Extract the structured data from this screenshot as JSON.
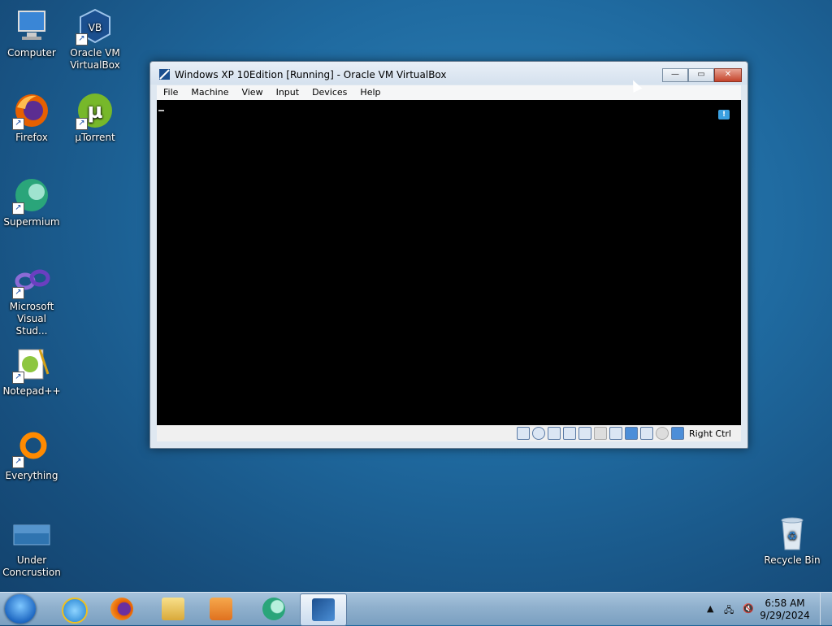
{
  "desktop": {
    "icons": [
      {
        "label": "Computer",
        "icon": "computer-icon"
      },
      {
        "label": "Oracle VM VirtualBox",
        "icon": "virtualbox-icon"
      },
      {
        "label": "Firefox",
        "icon": "firefox-icon"
      },
      {
        "label": "µTorrent",
        "icon": "utorrent-icon"
      },
      {
        "label": "Supermium",
        "icon": "supermium-icon"
      },
      {
        "label": "Microsoft Visual Stud...",
        "icon": "visual-studio-icon"
      },
      {
        "label": "Notepad++",
        "icon": "notepad-plus-plus-icon"
      },
      {
        "label": "Everything",
        "icon": "everything-icon"
      },
      {
        "label": "Under Concrustion",
        "icon": "folder-image-icon"
      },
      {
        "label": "Recycle Bin",
        "icon": "recycle-bin-icon"
      }
    ]
  },
  "window": {
    "title": "Windows XP 10Edition [Running] - Oracle VM VirtualBox",
    "menu": [
      "File",
      "Machine",
      "View",
      "Input",
      "Devices",
      "Help"
    ],
    "host_key": "Right Ctrl",
    "status_icons": [
      "hard-disk-icon",
      "optical-drive-icon",
      "audio-icon",
      "network-icon",
      "usb-icon",
      "shared-folders-icon",
      "display-icon",
      "video-capture-icon",
      "cpu-icon",
      "mouse-integration-icon",
      "keyboard-icon"
    ]
  },
  "taskbar": {
    "pinned": [
      "internet-explorer-icon",
      "firefox-icon",
      "explorer-icon",
      "media-player-icon",
      "supermium-icon",
      "virtualbox-xp-icon"
    ],
    "clock_time": "6:58 AM",
    "clock_date": "9/29/2024"
  },
  "colors": {
    "desktop_bg": "#1f6aa0",
    "vm_screen": "#000000",
    "taskbar": "#8fb0cd"
  }
}
